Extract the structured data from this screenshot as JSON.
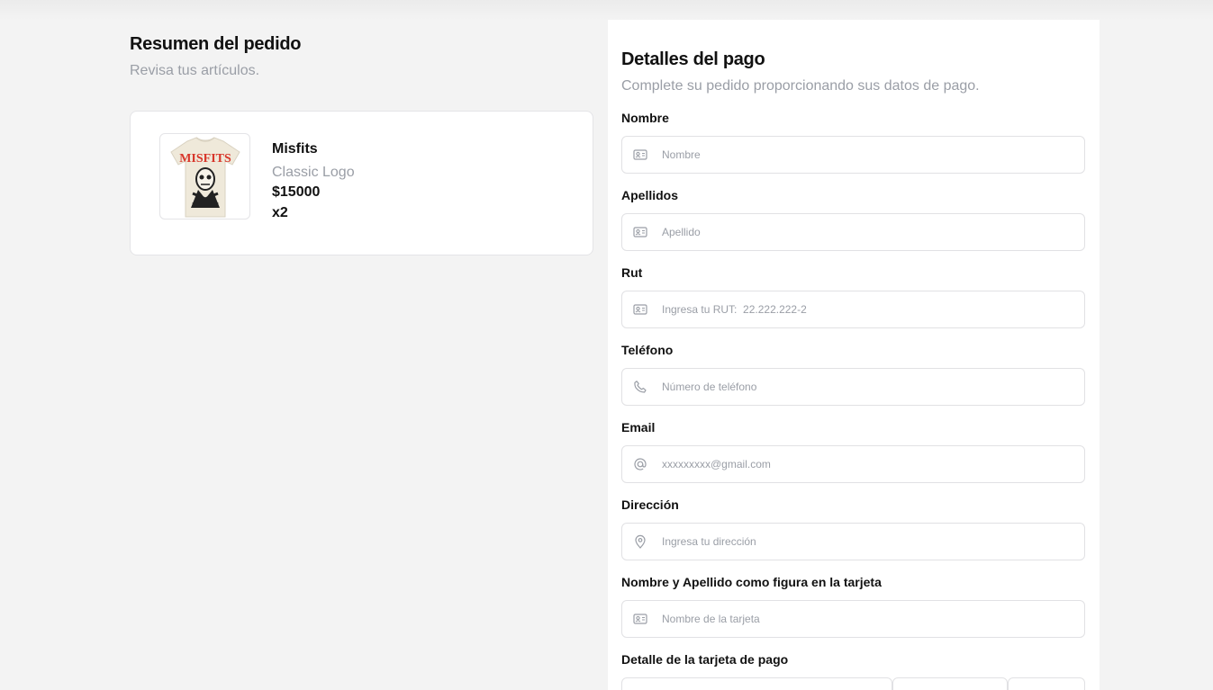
{
  "summary": {
    "title": "Resumen del pedido",
    "subtitle": "Revisa tus artículos.",
    "items": [
      {
        "name": "Misfits",
        "variant": "Classic Logo",
        "price": "$15000",
        "quantity": "x2",
        "image_text": "MISFITS"
      }
    ]
  },
  "payment": {
    "title": "Detalles del pago",
    "subtitle": "Complete su pedido proporcionando sus datos de pago.",
    "fields": {
      "nombre": {
        "label": "Nombre",
        "placeholder": "Nombre",
        "icon": "id-card-icon"
      },
      "apellidos": {
        "label": "Apellidos",
        "placeholder": "Apellido",
        "icon": "id-card-icon"
      },
      "rut": {
        "label": "Rut",
        "placeholder": "Ingresa tu RUT:  22.222.222-2",
        "icon": "id-card-icon"
      },
      "telefono": {
        "label": "Teléfono",
        "placeholder": "Número de teléfono",
        "icon": "phone-icon"
      },
      "email": {
        "label": "Email",
        "placeholder": "xxxxxxxxx@gmail.com",
        "icon": "at-sign-icon"
      },
      "direccion": {
        "label": "Dirección",
        "placeholder": "Ingresa tu dirección",
        "icon": "map-pin-icon"
      },
      "nombre_tarjeta": {
        "label": "Nombre y Apellido como figura en la tarjeta",
        "placeholder": "Nombre de la tarjeta",
        "icon": "id-card-icon"
      }
    },
    "card_detail_label": "Detalle de la tarjeta de pago"
  },
  "colors": {
    "background": "#f3f3f3",
    "card": "#ffffff",
    "muted_text": "#9a9ea6",
    "border": "#e1e1e4",
    "logo_red": "#d8362a"
  }
}
